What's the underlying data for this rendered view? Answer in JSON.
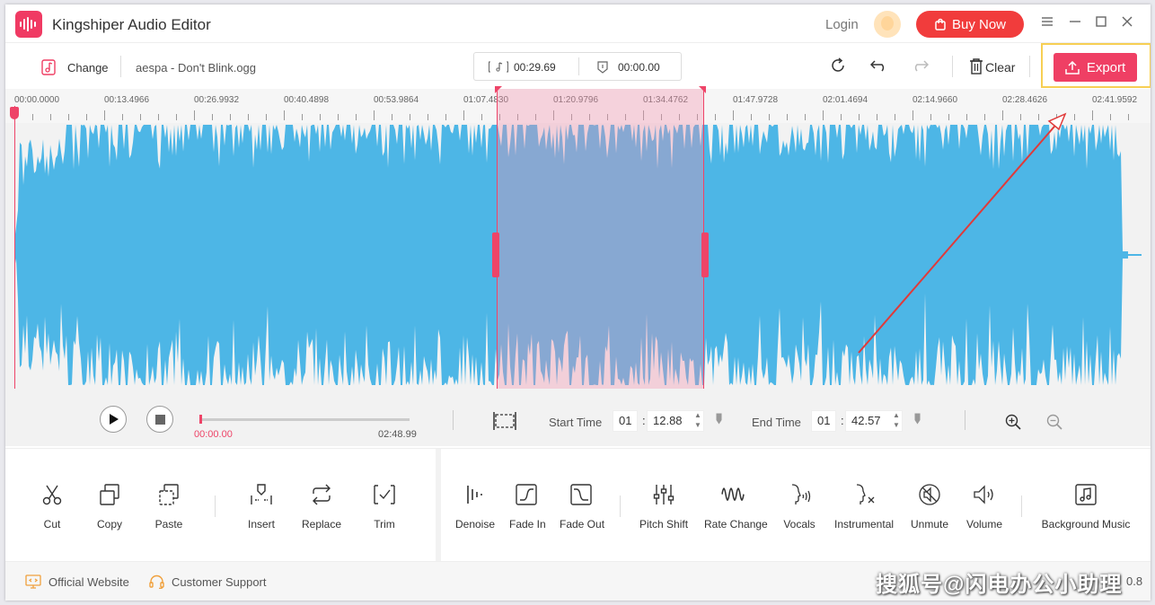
{
  "app": {
    "title": "Kingshiper Audio Editor",
    "login_label": "Login",
    "buy_label": "Buy Now"
  },
  "toolbar": {
    "change_label": "Change",
    "filename": "aespa - Don't Blink.ogg",
    "duration": "00:29.69",
    "position": "00:00.00",
    "clear_label": "Clear",
    "export_label": "Export"
  },
  "ruler": {
    "labels": [
      "00:00.0000",
      "00:13.4966",
      "00:26.9932",
      "00:40.4898",
      "00:53.9864",
      "01:07.4830",
      "01:20.9796",
      "01:34.4762",
      "01:47.9728",
      "02:01.4694",
      "02:14.9660",
      "02:28.4626",
      "02:41.9592"
    ]
  },
  "selection": {
    "start_fraction": 0.4298,
    "end_fraction": 0.6143
  },
  "playback": {
    "current": "00:00.00",
    "total": "02:48.99",
    "progress_fraction": 0.0
  },
  "range": {
    "start_label": "Start Time",
    "start_min": "01",
    "start_sec": "12.88",
    "end_label": "End Time",
    "end_min": "01",
    "end_sec": "42.57"
  },
  "tools": {
    "cut": "Cut",
    "copy": "Copy",
    "paste": "Paste",
    "insert": "Insert",
    "replace": "Replace",
    "trim": "Trim",
    "denoise": "Denoise",
    "fade_in": "Fade In",
    "fade_out": "Fade Out",
    "pitch_shift": "Pitch Shift",
    "rate_change": "Rate Change",
    "vocals": "Vocals",
    "instrumental": "Instrumental",
    "unmute": "Unmute",
    "volume": "Volume",
    "background_music": "Background Music"
  },
  "footer": {
    "website": "Official Website",
    "support": "Customer Support",
    "version": "0.8"
  },
  "watermark": "搜狐号@闪电办公小助理",
  "colors": {
    "accent": "#ef3f64",
    "waveform": "#4db6e6",
    "selection": "#f490ac",
    "buy": "#f13c3c",
    "highlight": "#f7cf54",
    "annotation_arrow": "#e03a3a"
  }
}
